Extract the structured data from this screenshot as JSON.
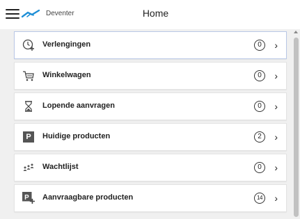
{
  "header": {
    "brand": "Deventer",
    "title": "Home"
  },
  "items": [
    {
      "label": "Verlengingen",
      "count": "0",
      "icon": "clock-plus-icon",
      "active": true
    },
    {
      "label": "Winkelwagen",
      "count": "0",
      "icon": "cart-icon"
    },
    {
      "label": "Lopende aanvragen",
      "count": "0",
      "icon": "hourglass-icon"
    },
    {
      "label": "Huidige producten",
      "count": "2",
      "icon": "product-p-icon"
    },
    {
      "label": "Wachtlijst",
      "count": "0",
      "icon": "queue-people-icon"
    },
    {
      "label": "Aanvraagbare producten",
      "count": "14",
      "icon": "product-p-plus-icon"
    }
  ],
  "colors": {
    "accent_border": "#b9c7e6",
    "logo": "#1f8fd6"
  }
}
